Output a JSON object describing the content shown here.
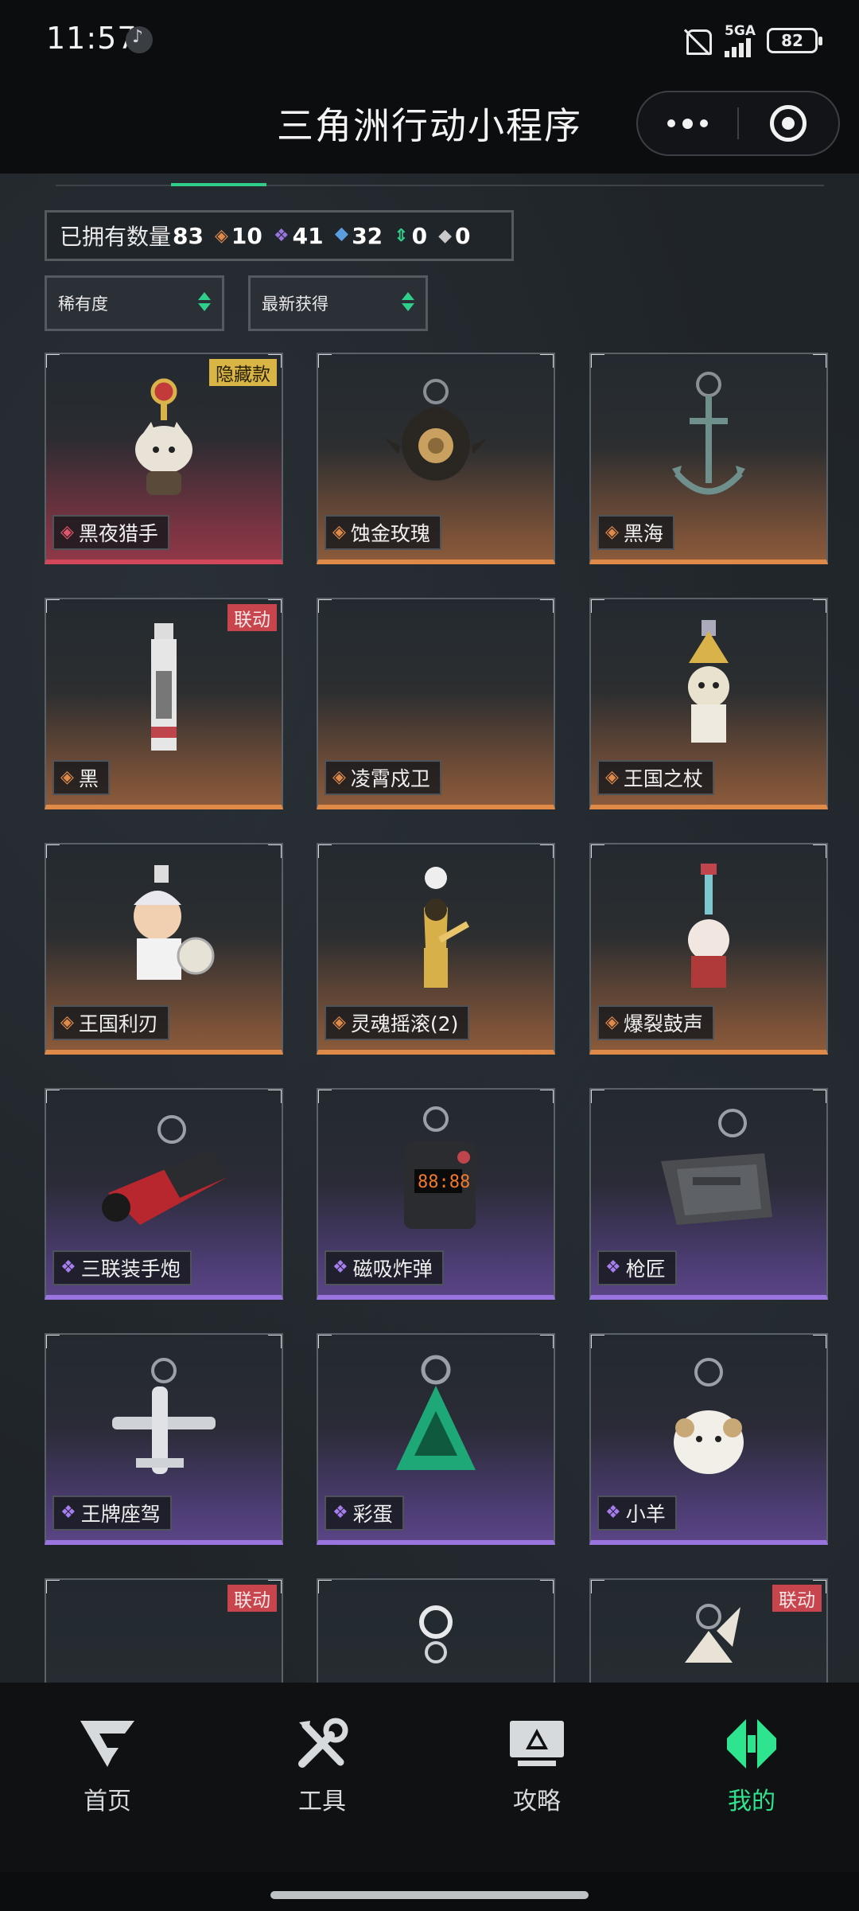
{
  "status_bar": {
    "time": "11:57",
    "network": "5GA",
    "battery": "82"
  },
  "header": {
    "title": "三角洲行动小程序"
  },
  "stats": {
    "owned_label": "已拥有数量",
    "owned_count": "83",
    "counts": [
      {
        "color": "#e08a4a",
        "value": "10"
      },
      {
        "color": "#9a75e0",
        "value": "41"
      },
      {
        "color": "#5a9ee0",
        "value": "32"
      },
      {
        "color": "#2fcf8a",
        "value": "0"
      },
      {
        "color": "#c9c9c9",
        "value": "0"
      }
    ]
  },
  "filters": {
    "rarity": "稀有度",
    "sort": "最新获得"
  },
  "tags": {
    "hidden": "隐藏款",
    "collab": "联动"
  },
  "items": [
    {
      "name": "黑夜猎手",
      "rarity": "red",
      "tag": "hidden"
    },
    {
      "name": "蚀金玫瑰",
      "rarity": "orange",
      "tag": ""
    },
    {
      "name": "黑海",
      "rarity": "orange",
      "tag": ""
    },
    {
      "name": "黑",
      "rarity": "orange",
      "tag": "collab"
    },
    {
      "name": "凌霄戍卫",
      "rarity": "orange",
      "tag": ""
    },
    {
      "name": "王国之杖",
      "rarity": "orange",
      "tag": ""
    },
    {
      "name": "王国利刃",
      "rarity": "orange",
      "tag": ""
    },
    {
      "name": "灵魂摇滚(2)",
      "rarity": "orange",
      "tag": ""
    },
    {
      "name": "爆裂鼓声",
      "rarity": "orange",
      "tag": ""
    },
    {
      "name": "三联装手炮",
      "rarity": "purple",
      "tag": ""
    },
    {
      "name": "磁吸炸弹",
      "rarity": "purple",
      "tag": ""
    },
    {
      "name": "枪匠",
      "rarity": "purple",
      "tag": ""
    },
    {
      "name": "王牌座驾",
      "rarity": "purple",
      "tag": ""
    },
    {
      "name": "彩蛋",
      "rarity": "purple",
      "tag": ""
    },
    {
      "name": "小羊",
      "rarity": "purple",
      "tag": ""
    }
  ],
  "partial_row_tags": [
    "联动",
    "",
    "联动"
  ],
  "nav": [
    {
      "label": "首页",
      "icon": "home-logo-icon"
    },
    {
      "label": "工具",
      "icon": "tools-icon"
    },
    {
      "label": "攻略",
      "icon": "guide-monitor-icon"
    },
    {
      "label": "我的",
      "icon": "profile-logo-icon",
      "active": true
    }
  ],
  "colors": {
    "accent": "#2fe48f",
    "red": "#d2475a",
    "orange": "#e08a4a",
    "purple": "#9a75e0"
  }
}
